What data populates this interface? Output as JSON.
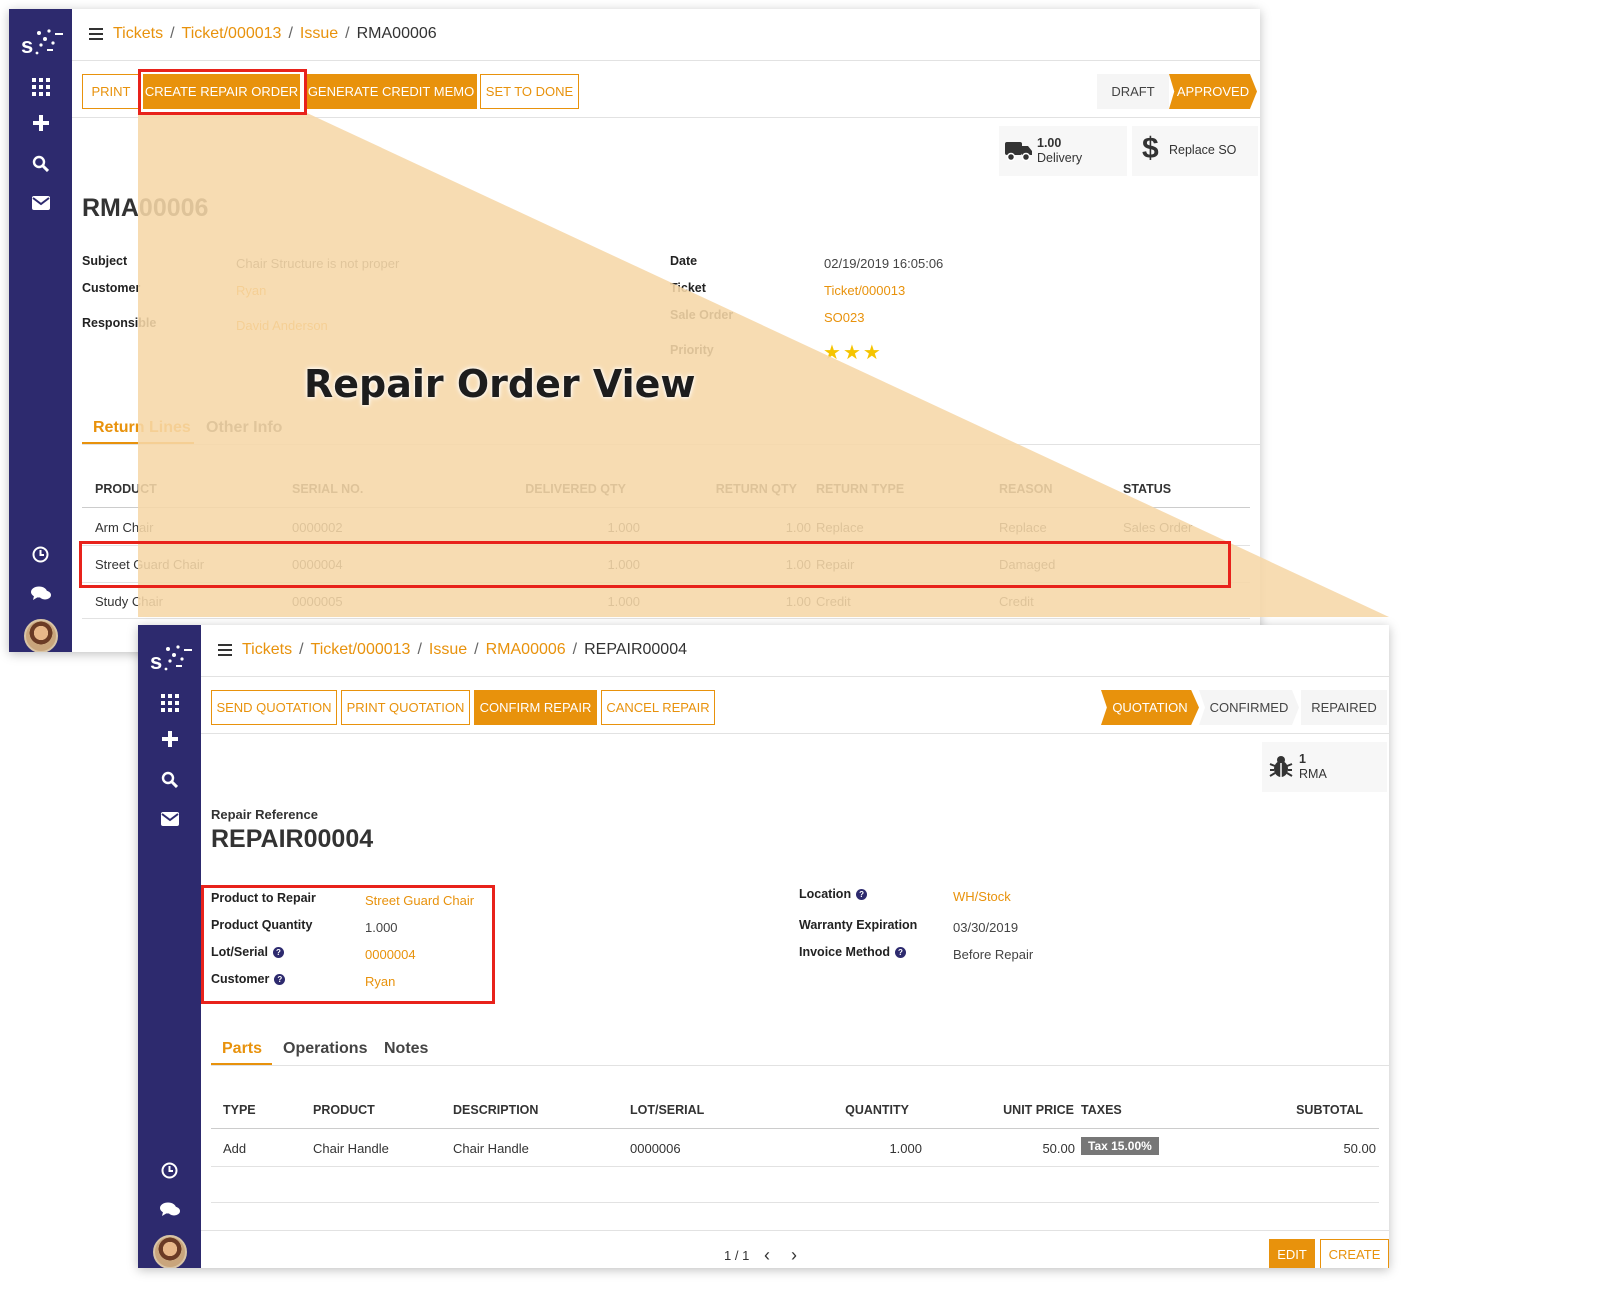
{
  "overlay_caption": "Repair Order View",
  "rma": {
    "breadcrumb": [
      "Tickets",
      "Ticket/000013",
      "Issue",
      "RMA00006"
    ],
    "buttons": [
      "PRINT",
      "CREATE REPAIR ORDER",
      "GENERATE CREDIT MEMO",
      "SET TO DONE"
    ],
    "statuses": [
      "DRAFT",
      "APPROVED"
    ],
    "smart_delivery": {
      "value": "1.00",
      "label": "Delivery"
    },
    "smart_replace": {
      "label": "Replace SO"
    },
    "title": "RMA00006",
    "fields": {
      "subject_label": "Subject",
      "subject": "Chair Structure is not proper",
      "customer_label": "Customer",
      "customer": "Ryan",
      "responsible_label": "Responsible",
      "responsible": "David Anderson",
      "date_label": "Date",
      "date": "02/19/2019 16:05:06",
      "ticket_label": "Ticket",
      "ticket": "Ticket/000013",
      "sale_order_label": "Sale Order",
      "sale_order": "SO023",
      "priority_label": "Priority",
      "priority_stars": 3
    },
    "tabs": [
      "Return Lines",
      "Other Info"
    ],
    "columns": [
      "PRODUCT",
      "SERIAL NO.",
      "DELIVERED QTY",
      "RETURN QTY",
      "RETURN TYPE",
      "REASON",
      "STATUS"
    ],
    "rows": [
      [
        "Arm Chair",
        "0000002",
        "1.000",
        "1.00",
        "Replace",
        "Replace",
        "Sales Order"
      ],
      [
        "Street Guard Chair",
        "0000004",
        "1.000",
        "1.00",
        "Repair",
        "Damaged",
        ""
      ],
      [
        "Study Chair",
        "0000005",
        "1.000",
        "1.00",
        "Credit",
        "Credit",
        ""
      ]
    ]
  },
  "repair": {
    "breadcrumb": [
      "Tickets",
      "Ticket/000013",
      "Issue",
      "RMA00006",
      "REPAIR00004"
    ],
    "buttons": [
      "SEND QUOTATION",
      "PRINT QUOTATION",
      "CONFIRM REPAIR",
      "CANCEL REPAIR"
    ],
    "statuses": [
      "QUOTATION",
      "CONFIRMED",
      "REPAIRED"
    ],
    "smart_rma": {
      "value": "1",
      "label": "RMA"
    },
    "ref_label": "Repair Reference",
    "title": "REPAIR00004",
    "fields": {
      "product_label": "Product to Repair",
      "product": "Street Guard Chair",
      "qty_label": "Product Quantity",
      "qty": "1.000",
      "lot_label": "Lot/Serial",
      "lot": "0000004",
      "customer_label": "Customer",
      "customer": "Ryan",
      "location_label": "Location",
      "location": "WH/Stock",
      "warranty_label": "Warranty Expiration",
      "warranty": "03/30/2019",
      "invoice_label": "Invoice Method",
      "invoice": "Before Repair"
    },
    "tabs": [
      "Parts",
      "Operations",
      "Notes"
    ],
    "columns": [
      "TYPE",
      "PRODUCT",
      "DESCRIPTION",
      "LOT/SERIAL",
      "QUANTITY",
      "UNIT PRICE",
      "TAXES",
      "SUBTOTAL"
    ],
    "row": {
      "type": "Add",
      "product": "Chair Handle",
      "description": "Chair Handle",
      "lot": "0000006",
      "quantity": "1.000",
      "unit_price": "50.00",
      "tax": "Tax 15.00%",
      "subtotal": "50.00"
    },
    "pager": "1 / 1",
    "edit": "EDIT",
    "create": "CREATE"
  },
  "colors": {
    "accent": "#e8920c",
    "sidebar": "#2d2a6e",
    "highlight": "#e8221b",
    "overlay": "#f6d7a7"
  }
}
